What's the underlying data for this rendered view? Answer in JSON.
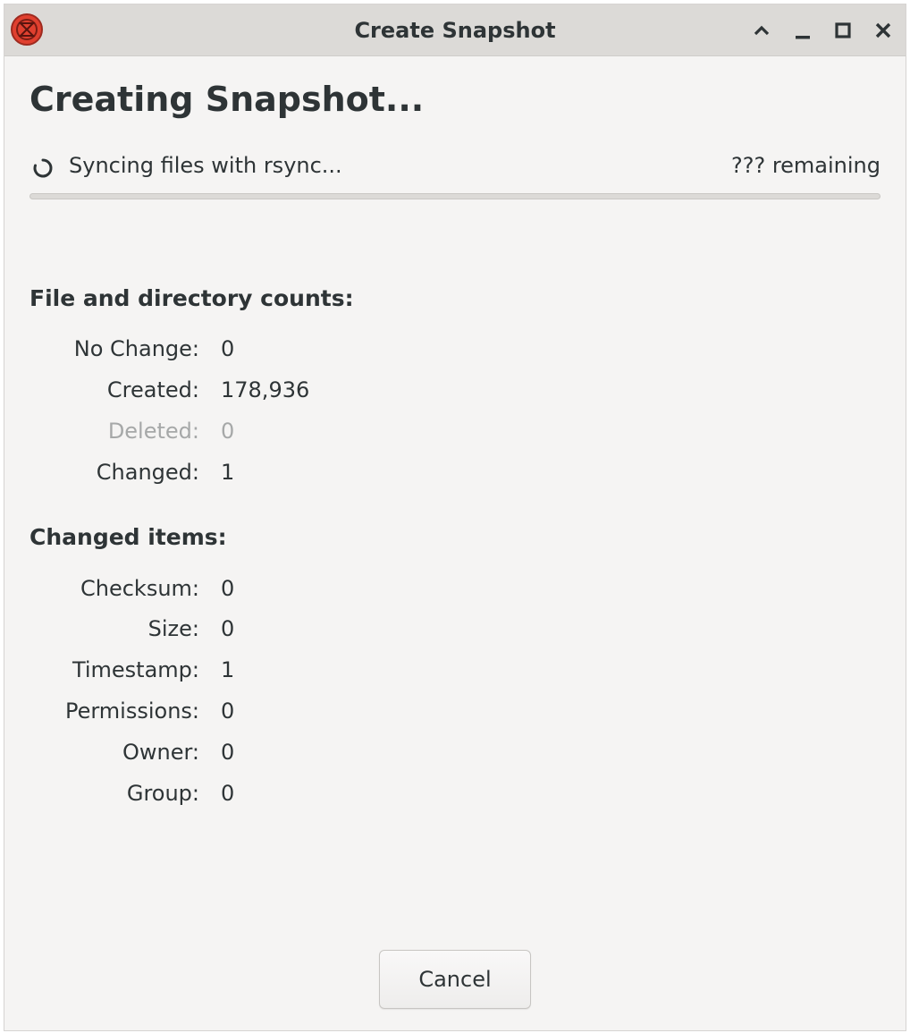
{
  "window": {
    "title": "Create Snapshot",
    "controls": [
      "chevron-up",
      "minimize",
      "maximize",
      "close"
    ]
  },
  "heading": "Creating Snapshot...",
  "status": {
    "text": "Syncing files with rsync...",
    "remaining": "??? remaining",
    "progress_fraction": 0
  },
  "counts": {
    "title": "File and directory counts:",
    "rows": [
      {
        "label": "No Change:",
        "value": "0"
      },
      {
        "label": "Created:",
        "value": "178,936"
      },
      {
        "label": "Deleted:",
        "value": "0"
      },
      {
        "label": "Changed:",
        "value": "1"
      }
    ]
  },
  "changed_items": {
    "title": "Changed items:",
    "rows": [
      {
        "label": "Checksum:",
        "value": "0"
      },
      {
        "label": "Size:",
        "value": "0"
      },
      {
        "label": "Timestamp:",
        "value": "1"
      },
      {
        "label": "Permissions:",
        "value": "0"
      },
      {
        "label": "Owner:",
        "value": "0"
      },
      {
        "label": "Group:",
        "value": "0"
      }
    ]
  },
  "cancel_label": "Cancel",
  "colors": {
    "accent": "#3584e4",
    "icon_red": "#e0402f",
    "dim_text": "#a6a8a8"
  }
}
